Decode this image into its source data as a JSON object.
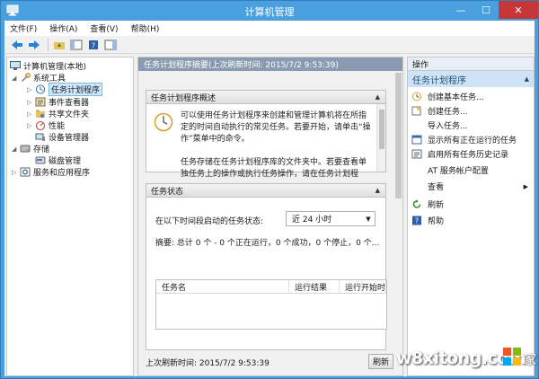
{
  "window": {
    "title": "计算机管理"
  },
  "menu": [
    "文件(F)",
    "操作(A)",
    "查看(V)",
    "帮助(H)"
  ],
  "tree": {
    "root": "计算机管理(本地)",
    "system_tools": "系统工具",
    "task_scheduler": "任务计划程序",
    "event_viewer": "事件查看器",
    "shared_folders": "共享文件夹",
    "performance": "性能",
    "device_manager": "设备管理器",
    "storage": "存储",
    "disk_management": "磁盘管理",
    "services_apps": "服务和应用程序"
  },
  "middle": {
    "header": "任务计划程序摘要(上次刷新时间: 2015/7/2 9:53:39)",
    "overview_title": "任务计划程序概述",
    "overview_p1": "可以使用任务计划程序来创建和管理计算机将在所指定的时间自动执行的常见任务。若要开始，请单击“操作”菜单中的命令。",
    "overview_p2": "任务存储在任务计划程序库的文件夹中。若要查看单独任务上的操作或执行任务操作，请在任务计划程",
    "status_title": "任务状态",
    "status_label": "在以下时间段启动的任务状态:",
    "status_range": "近 24 小时",
    "summary": "摘要: 总计 0 个 - 0 个正在运行，0 个成功，0 个停止，0 个...",
    "table_headers": [
      "任务名",
      "运行结果",
      "运行开始时"
    ],
    "footer_time": "上次刷新时间: 2015/7/2 9:53:39",
    "refresh_button": "刷新"
  },
  "actions": {
    "header": "操作",
    "section": "任务计划程序",
    "items": [
      {
        "label": "创建基本任务...",
        "icon": "create-basic-task-icon"
      },
      {
        "label": "创建任务...",
        "icon": "create-task-icon"
      },
      {
        "label": "导入任务...",
        "icon": ""
      },
      {
        "label": "显示所有正在运行的任务",
        "icon": "running-tasks-icon"
      },
      {
        "label": "启用所有任务历史记录",
        "icon": "task-history-icon"
      },
      {
        "label": "AT 服务帐户配置",
        "icon": ""
      },
      {
        "label": "查看",
        "icon": ""
      },
      {
        "label": "刷新",
        "icon": "refresh-icon"
      },
      {
        "label": "帮助",
        "icon": "help-icon"
      }
    ]
  },
  "watermark": {
    "text": "w8xitong.com",
    "suffix": "家"
  },
  "colors": {
    "titlebar": "#4aa0de",
    "close": "#c7373a",
    "selection": "#cde8ff",
    "mid_header": "#8a9ab0"
  }
}
